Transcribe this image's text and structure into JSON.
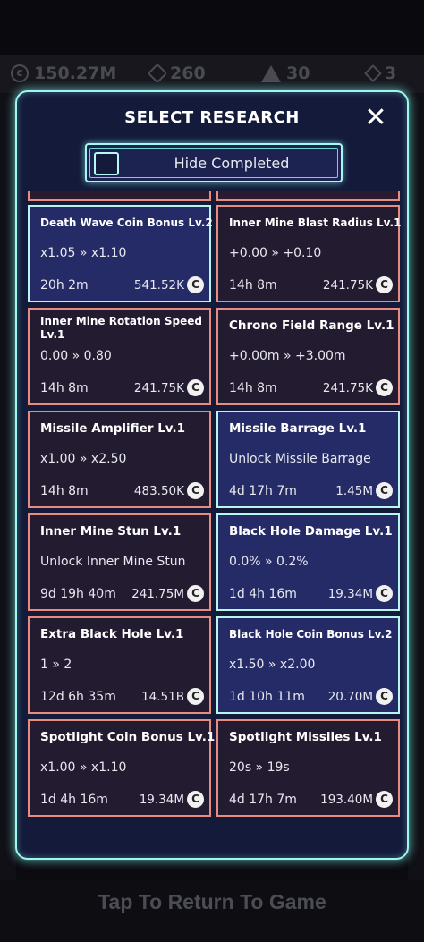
{
  "background": {
    "coins": "150.27M",
    "gems": "260",
    "medals": "30",
    "stones": "3",
    "tap_text": "Tap To Return To Game"
  },
  "modal": {
    "title": "SELECT RESEARCH",
    "close_icon": "close-icon",
    "hide_completed_label": "Hide Completed"
  },
  "colors": {
    "card_border_red": "#e88c80",
    "card_border_blue": "#b8f5ef",
    "modal_border": "#9ef6ef"
  },
  "cards": [
    {
      "name": "Death Wave Coin Bonus Lv.2",
      "value": "x1.05 » x1.10",
      "time": "20h 2m",
      "cost": "541.52K",
      "style": "blue"
    },
    {
      "name": "Inner Mine Blast Radius Lv.1",
      "value": "+0.00 » +0.10",
      "time": "14h 8m",
      "cost": "241.75K",
      "style": "red"
    },
    {
      "name": "Inner Mine Rotation Speed Lv.1",
      "value": "0.00 » 0.80",
      "time": "14h 8m",
      "cost": "241.75K",
      "style": "red"
    },
    {
      "name": "Chrono Field Range Lv.1",
      "value": "+0.00m » +3.00m",
      "time": "14h 8m",
      "cost": "241.75K",
      "style": "red"
    },
    {
      "name": "Missile Amplifier Lv.1",
      "value": "x1.00 » x2.50",
      "time": "14h 8m",
      "cost": "483.50K",
      "style": "red"
    },
    {
      "name": "Missile Barrage Lv.1",
      "value": "Unlock Missile Barrage",
      "time": "4d 17h 7m",
      "cost": "1.45M",
      "style": "blue"
    },
    {
      "name": "Inner Mine Stun Lv.1",
      "value": "Unlock Inner Mine Stun",
      "time": "9d 19h 40m",
      "cost": "241.75M",
      "style": "red"
    },
    {
      "name": "Black Hole Damage Lv.1",
      "value": "0.0% » 0.2%",
      "time": "1d 4h 16m",
      "cost": "19.34M",
      "style": "blue"
    },
    {
      "name": "Extra Black Hole Lv.1",
      "value": "1 » 2",
      "time": "12d 6h 35m",
      "cost": "14.51B",
      "style": "red"
    },
    {
      "name": "Black Hole Coin Bonus Lv.2",
      "value": "x1.50 » x2.00",
      "time": "1d 10h 11m",
      "cost": "20.70M",
      "style": "blue"
    },
    {
      "name": "Spotlight Coin Bonus Lv.1",
      "value": "x1.00 » x1.10",
      "time": "1d 4h 16m",
      "cost": "19.34M",
      "style": "red"
    },
    {
      "name": "Spotlight Missiles Lv.1",
      "value": "20s » 19s",
      "time": "4d 17h 7m",
      "cost": "193.40M",
      "style": "red"
    }
  ]
}
